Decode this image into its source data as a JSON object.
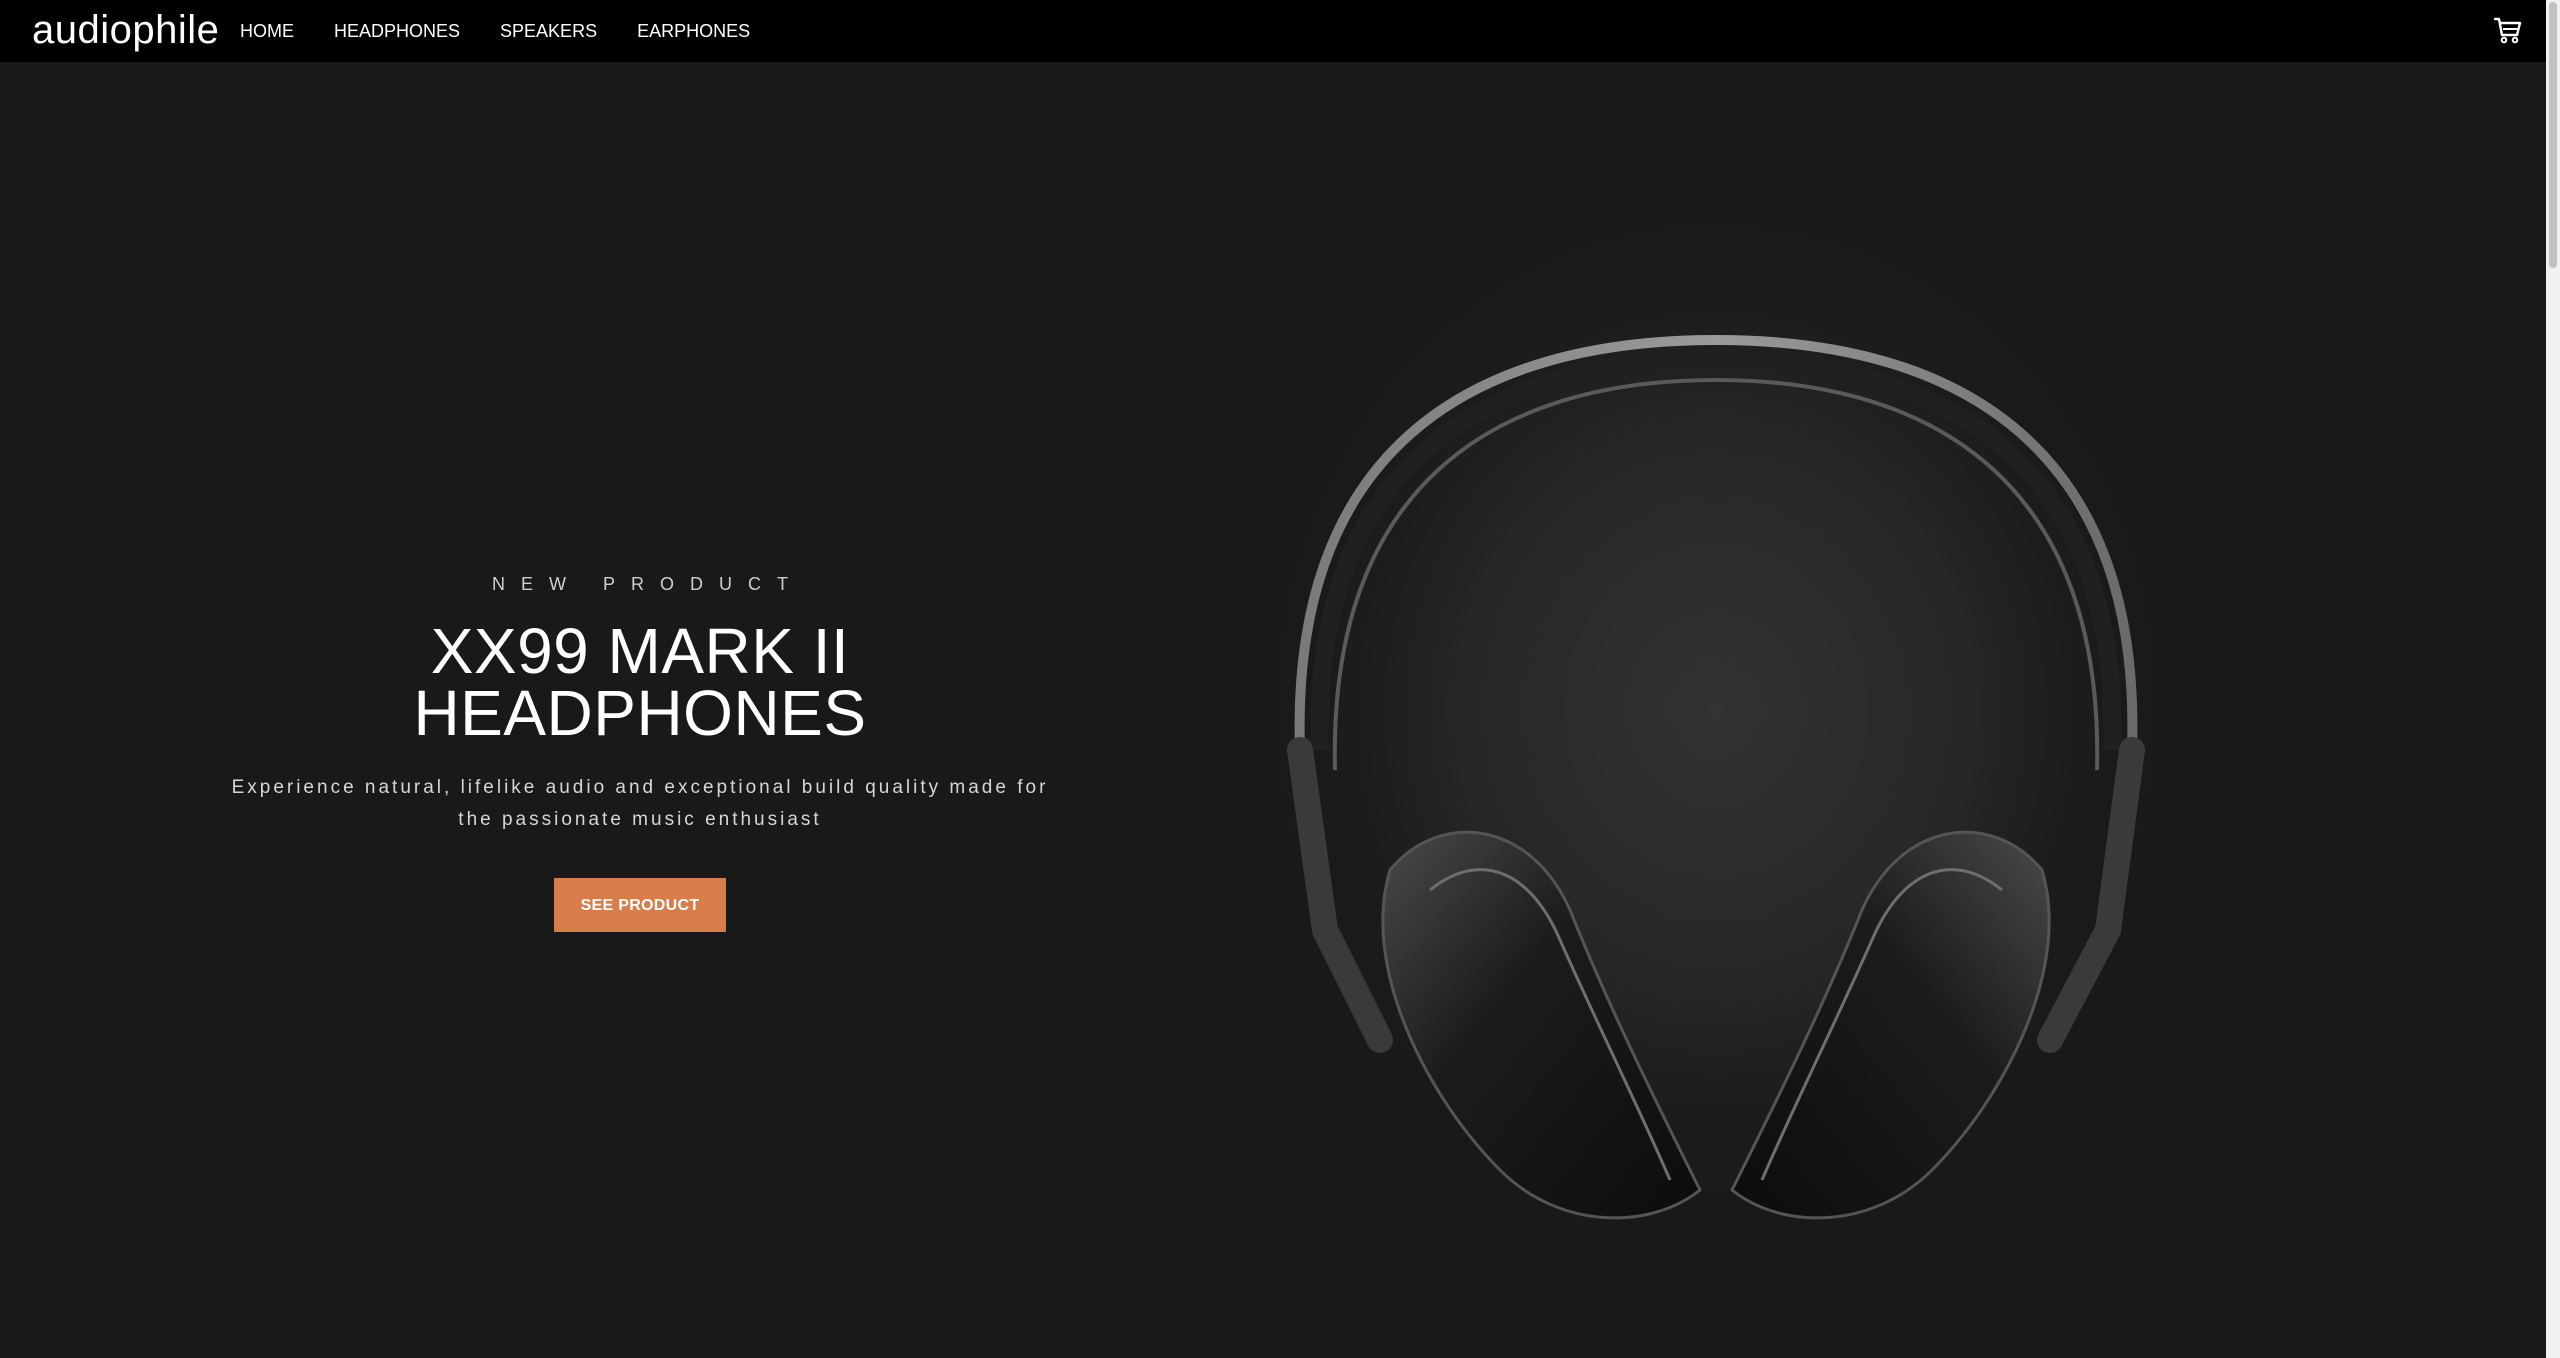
{
  "header": {
    "logo": "audiophile",
    "nav": [
      {
        "label": "HOME"
      },
      {
        "label": "HEADPHONES"
      },
      {
        "label": "SPEAKERS"
      },
      {
        "label": "EARPHONES"
      }
    ],
    "cart_icon": "cart-icon"
  },
  "hero": {
    "overline": "NEW PRODUCT",
    "title_line1": "XX99 MARK II",
    "title_line2": "HEADPHONES",
    "description": "Experience natural, lifelike audio and exceptional build quality made for the passionate music enthusiast",
    "cta_label": "SEE PRODUCT",
    "image_icon": "headphones-image"
  },
  "colors": {
    "background": "#191919",
    "nav_background": "#000000",
    "accent": "#d87d4a"
  }
}
